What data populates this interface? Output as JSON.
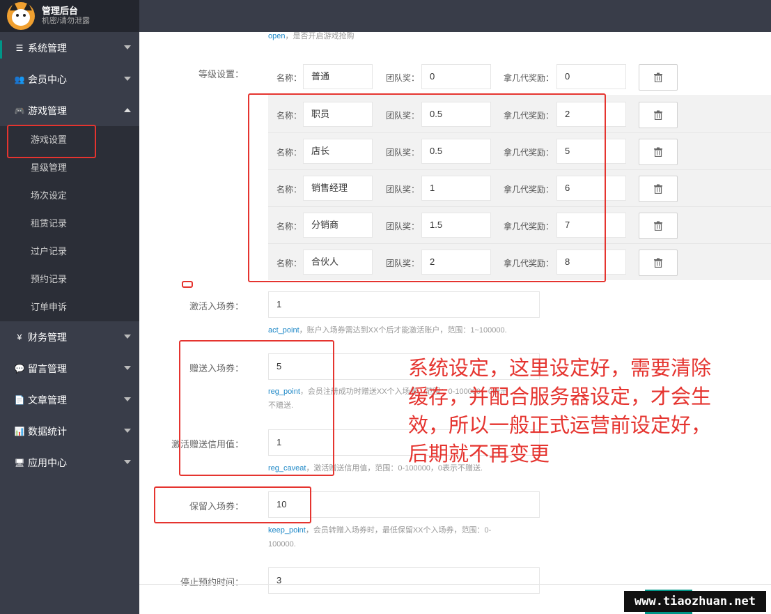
{
  "brand": {
    "title": "管理后台",
    "subtitle": "机密/请勿泄露"
  },
  "sidebar": {
    "items": [
      {
        "icon": "☰",
        "icon_name": "list-icon",
        "label": "系统管理"
      },
      {
        "icon": "👥",
        "icon_name": "users-icon",
        "label": "会员中心"
      },
      {
        "icon": "🎮",
        "icon_name": "gamepad-icon",
        "label": "游戏管理"
      },
      {
        "icon": "¥",
        "icon_name": "yen-icon",
        "label": "财务管理"
      },
      {
        "icon": "💬",
        "icon_name": "comment-icon",
        "label": "留言管理"
      },
      {
        "icon": "📄",
        "icon_name": "file-icon",
        "label": "文章管理"
      },
      {
        "icon": "📊",
        "icon_name": "bar-chart-icon",
        "label": "数据统计"
      },
      {
        "icon": "🖥",
        "icon_name": "monitor-icon",
        "label": "应用中心"
      }
    ],
    "game_sub": [
      "游戏设置",
      "星级管理",
      "场次设定",
      "租赁记录",
      "过户记录",
      "预约记录",
      "订单申诉"
    ]
  },
  "form": {
    "open_help_key": "open",
    "open_help": "，是否开启游戏抢购",
    "level_label": "等级设置：",
    "level_name_label": "名称：",
    "level_team_label": "团队奖：",
    "level_gen_label": "拿几代奖励：",
    "levels": [
      {
        "name": "普通",
        "team": "0",
        "gen": "0"
      },
      {
        "name": "职员",
        "team": "0.5",
        "gen": "2"
      },
      {
        "name": "店长",
        "team": "0.5",
        "gen": "5"
      },
      {
        "name": "销售经理",
        "team": "1",
        "gen": "6"
      },
      {
        "name": "分销商",
        "team": "1.5",
        "gen": "7"
      },
      {
        "name": "合伙人",
        "team": "2",
        "gen": "8"
      }
    ],
    "act_label": "激活入场券：",
    "act_value": "1",
    "act_help_key": "act_point",
    "act_help": "，账户入场券需达到XX个后才能激活账户，范围：1~100000.",
    "reg_label": "赠送入场券：",
    "reg_value": "5",
    "reg_help_key": "reg_point",
    "reg_help_1": "，会员注册成功时赠送XX个入场券，范围：0-100000，0表示",
    "reg_help_2": "不赠送.",
    "caveat_label": "激活赠送信用值：",
    "caveat_value": "1",
    "caveat_help_key": "reg_caveat",
    "caveat_help": "，激活赠送信用值，范围：0-100000，0表示不赠送.",
    "keep_label": "保留入场券：",
    "keep_value": "10",
    "keep_help_key": "keep_point",
    "keep_help_1": "，会员转赠入场券时，最低保留XX个入场券，范围：0-",
    "keep_help_2": "100000.",
    "stop_label": "停止预约时间：",
    "stop_value": "3"
  },
  "annotation": {
    "lines": [
      "系统设定，这里设定好，需要清除",
      "缓存，并配合服务器设定，才会生",
      "效，所以一般正式运营前设定好，",
      "后期就不再变更"
    ],
    "color": "#e5342f"
  },
  "watermark": "www.tiaozhuan.net"
}
